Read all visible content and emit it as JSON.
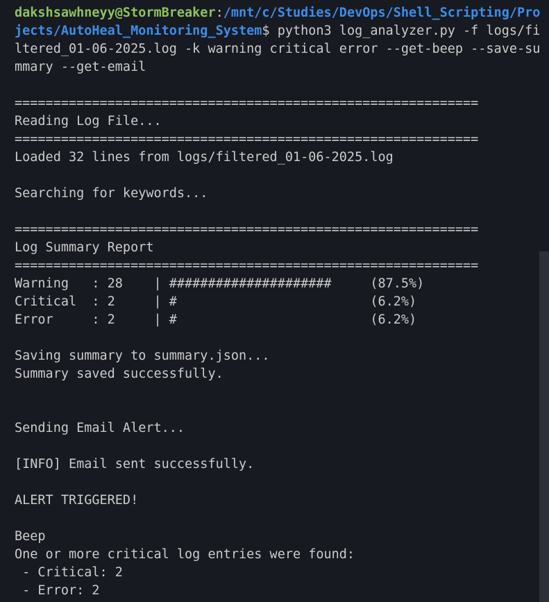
{
  "prompt": {
    "user_host": "dakshsawhneyy@StormBreaker",
    "separator": ":",
    "path": "/mnt/c/Studies/DevOps/Shell_Scripting/Projects/AutoHeal_Monitoring_System",
    "symbol": "$",
    "command": " python3 log_analyzer.py -f logs/filtered_01-06-2025.log -k warning critical error --get-beep --save-summary --get-email"
  },
  "output": [
    "",
    "============================================================",
    "Reading Log File...",
    "============================================================",
    "Loaded 32 lines from logs/filtered_01-06-2025.log",
    "",
    "Searching for keywords...",
    "",
    "============================================================",
    "Log Summary Report",
    "============================================================",
    "Warning   : 28    | #####################     (87.5%)",
    "Critical  : 2     | #                         (6.2%)",
    "Error     : 2     | #                         (6.2%)",
    "",
    "Saving summary to summary.json...",
    "Summary saved successfully.",
    "",
    "",
    "Sending Email Alert...",
    "",
    "[INFO] Email sent successfully.",
    "",
    "ALERT TRIGGERED!",
    "",
    "Beep",
    "One or more critical log entries were found:",
    " - Critical: 2",
    " - Error: 2"
  ],
  "colors": {
    "background": "#181a21",
    "user_host": "#8fc25f",
    "path": "#3b8eea",
    "text": "#cccccc",
    "scrollbar": "#2e3038"
  }
}
